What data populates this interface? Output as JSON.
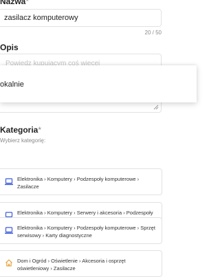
{
  "name_field": {
    "label": "Nazwa",
    "required_mark": "*",
    "value": "zasilacz komputerowy",
    "counter": "20 / 50"
  },
  "description_field": {
    "label": "Opis",
    "placeholder": "Powiedz kupującym coś więcej"
  },
  "location_dropdown": {
    "option": "okalnie"
  },
  "category": {
    "label": "Kategoria",
    "required_mark": "*",
    "hint": "Wybierz kategorię:",
    "suggestions": [
      {
        "icon": "laptop-icon",
        "path": "Elektronika › Komputery › Podzespoły komputerowe › Zasilacze"
      },
      {
        "icon": "laptop-icon",
        "path": "Elektronika › Komputery › Serwery i akcesoria › Podzespoły serwerowe › Zasilacze"
      },
      {
        "icon": "laptop-icon",
        "path": "Elektronika › Komputery › Podzespoły komputerowe › Sprzęt serwisowy › Karty diagnostyczne"
      },
      {
        "icon": "home-icon",
        "path": "Dom i Ogród › Oświetlenie › Akcesoria i osprzęt oświetleniowy › Zasilacze"
      }
    ]
  },
  "colors": {
    "laptop_icon": "#3a5bd9",
    "home_icon": "#e8a03a"
  }
}
